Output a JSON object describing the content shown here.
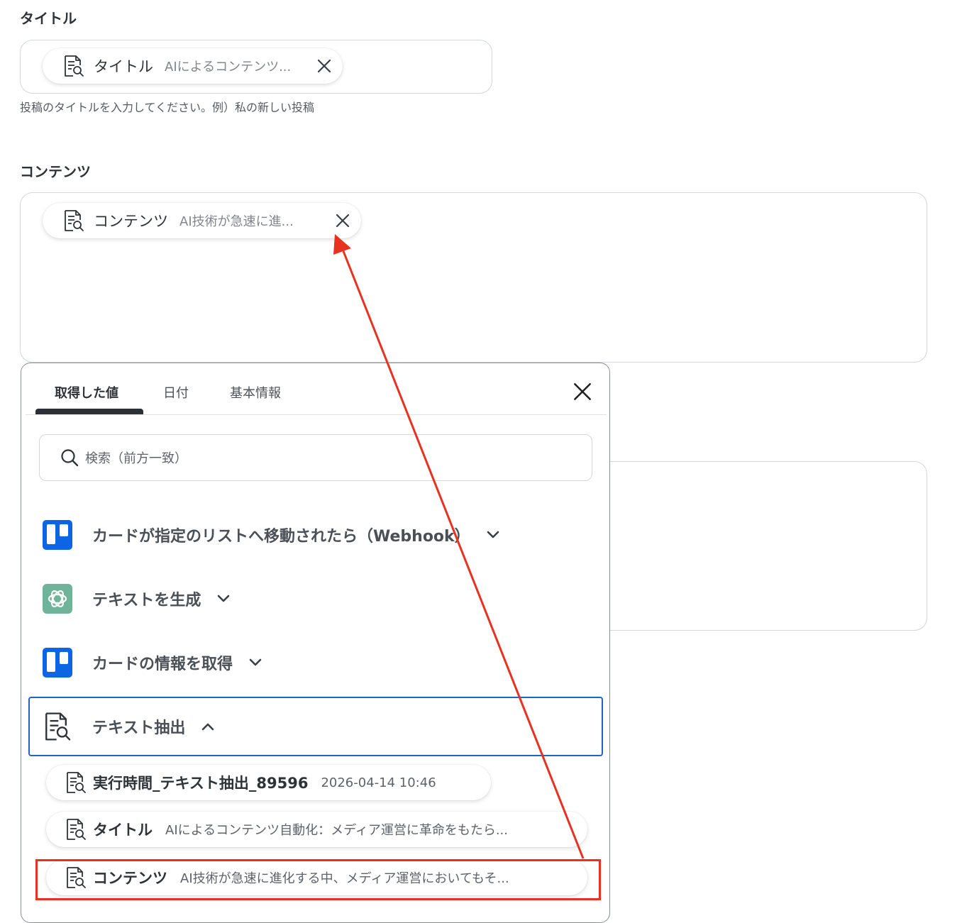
{
  "title_field": {
    "label": "タイトル",
    "chip": {
      "name": "タイトル",
      "value": "AIによるコンテンツ..."
    },
    "hint": "投稿のタイトルを入力してください。例）私の新しい投稿"
  },
  "content_field": {
    "label": "コンテンツ",
    "chip": {
      "name": "コンテンツ",
      "value": "AI技術が急速に進..."
    }
  },
  "panel": {
    "tabs": [
      {
        "label": "取得した値",
        "active": true
      },
      {
        "label": "日付",
        "active": false
      },
      {
        "label": "基本情報",
        "active": false
      }
    ],
    "search": {
      "placeholder": "検索（前方一致）"
    },
    "groups": [
      {
        "label": "カードが指定のリストへ移動されたら（Webhook）",
        "icon": "trello-icon",
        "expanded": false
      },
      {
        "label": "テキストを生成",
        "icon": "openai-icon",
        "expanded": false
      },
      {
        "label": "カードの情報を取得",
        "icon": "trello-icon",
        "expanded": false
      },
      {
        "label": "テキスト抽出",
        "icon": "doc-search-icon",
        "expanded": true
      }
    ],
    "items": [
      {
        "name": "実行時間_テキスト抽出_89596",
        "value": "2026-04-14 10:46"
      },
      {
        "name": "タイトル",
        "value": "AIによるコンテンツ自動化：メディア運営に革命をもたら..."
      },
      {
        "name": "コンテンツ",
        "value": "AI技術が急速に進化する中、メディア運営においてもそ..."
      }
    ]
  },
  "colors": {
    "accent_blue": "#1a66c8",
    "annotation_red": "#e8321f",
    "trello_blue": "#0c66e4",
    "openai_green": "#6fb39a"
  }
}
